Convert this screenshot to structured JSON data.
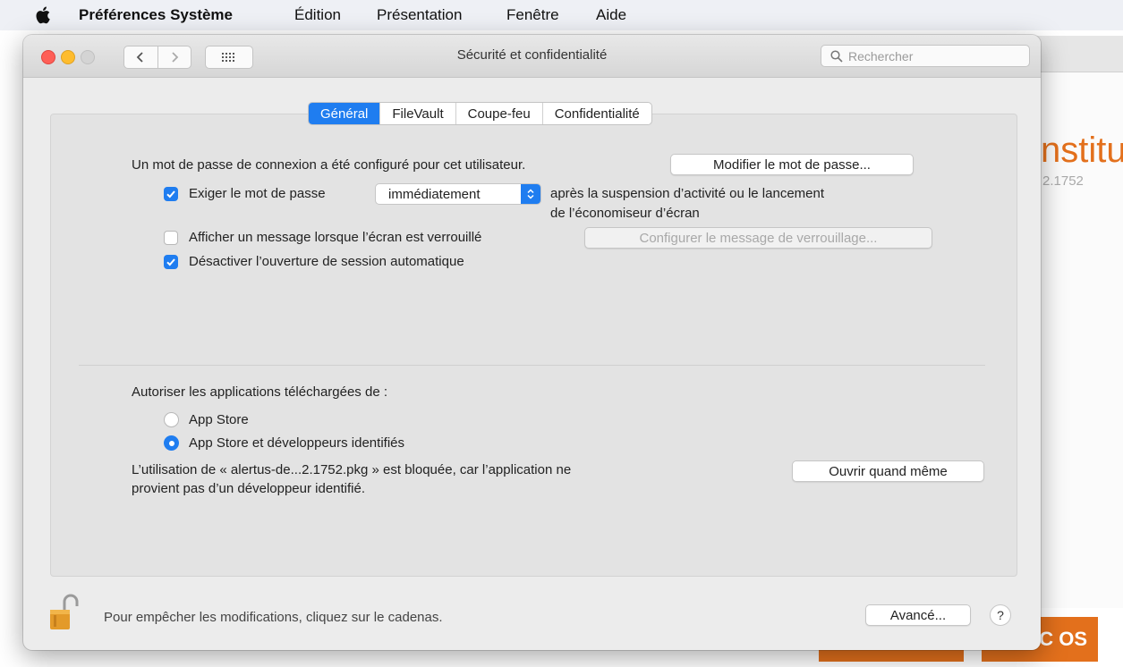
{
  "menubar": {
    "app_name": "Préférences Système",
    "items": [
      "Édition",
      "Présentation",
      "Fenêtre",
      "Aide"
    ]
  },
  "background_app": {
    "title": "nstitut",
    "version": "2.1752",
    "buttons": [
      "MAC OS"
    ]
  },
  "window": {
    "title": "Sécurité et confidentialité",
    "search_placeholder": "Rechercher"
  },
  "tabs": [
    "Général",
    "FileVault",
    "Coupe-feu",
    "Confidentialité"
  ],
  "active_tab": "Général",
  "general": {
    "password_text": "Un mot de passe de connexion a été configuré pour cet utilisateur.",
    "change_password_button": "Modifier le mot de passe...",
    "require_password": {
      "checked": true,
      "label": "Exiger le mot de passe",
      "delay_value": "immédiatement",
      "after_line1": "après la suspension d’activité ou le lancement",
      "after_line2": "de l’économiseur d’écran"
    },
    "show_message": {
      "checked": false,
      "label": "Afficher un message lorsque l’écran est verrouillé",
      "button": "Configurer le message de verrouillage..."
    },
    "disable_auto_login": {
      "checked": true,
      "label": "Désactiver l’ouverture de session automatique"
    },
    "allow_apps_label": "Autoriser les applications téléchargées de :",
    "radio_options": [
      "App Store",
      "App Store et développeurs identifiés"
    ],
    "radio_selected": 1,
    "blocked_line1": "L’utilisation de « alertus-de...2.1752.pkg » est bloquée, car l’application ne",
    "blocked_line2": "provient pas d’un développeur identifié.",
    "open_anyway_button": "Ouvrir quand même"
  },
  "footer": {
    "lock_text": "Pour empêcher les modifications, cliquez sur le cadenas.",
    "advanced_button": "Avancé...",
    "help_label": "?"
  },
  "colors": {
    "accent": "#1f7df0",
    "brand_orange": "#e3701c"
  }
}
